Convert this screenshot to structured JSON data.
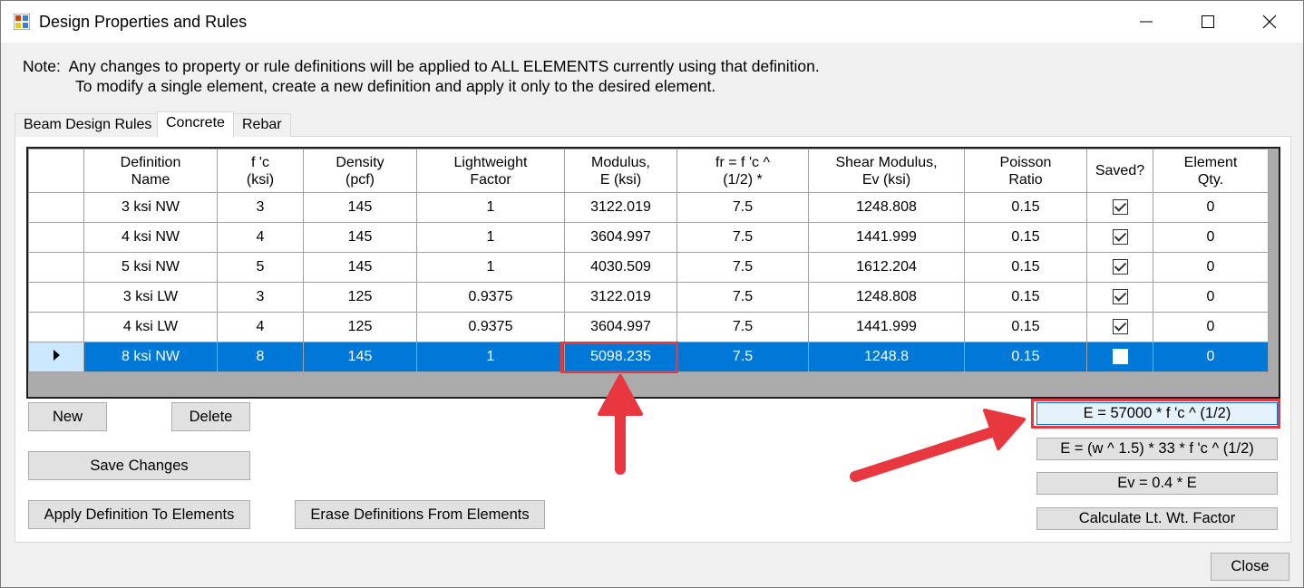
{
  "window": {
    "title": "Design Properties and Rules"
  },
  "note": {
    "line1": "Note:  Any changes to property or rule definitions will be applied to ALL ELEMENTS currently using that definition.",
    "line2": "To modify a single element, create a new definition and apply it only to the desired element."
  },
  "tabs": [
    {
      "label": "Beam Design Rules"
    },
    {
      "label": "Concrete"
    },
    {
      "label": "Rebar"
    }
  ],
  "grid": {
    "columns": [
      {
        "label": "Definition\nName"
      },
      {
        "label": "f 'c\n(ksi)"
      },
      {
        "label": "Density\n(pcf)"
      },
      {
        "label": "Lightweight\nFactor"
      },
      {
        "label": "Modulus,\nE (ksi)"
      },
      {
        "label": "fr = f 'c ^\n(1/2) *"
      },
      {
        "label": "Shear Modulus,\nEv (ksi)"
      },
      {
        "label": "Poisson\nRatio"
      },
      {
        "label": "Saved?"
      },
      {
        "label": "Element\nQty."
      }
    ],
    "rows": [
      {
        "name": "3 ksi NW",
        "fc": "3",
        "density": "145",
        "lw": "1",
        "modulus": "3122.019",
        "fr": "7.5",
        "shear": "1248.808",
        "poisson": "0.15",
        "saved": true,
        "qty": "0"
      },
      {
        "name": "4 ksi NW",
        "fc": "4",
        "density": "145",
        "lw": "1",
        "modulus": "3604.997",
        "fr": "7.5",
        "shear": "1441.999",
        "poisson": "0.15",
        "saved": true,
        "qty": "0"
      },
      {
        "name": "5 ksi NW",
        "fc": "5",
        "density": "145",
        "lw": "1",
        "modulus": "4030.509",
        "fr": "7.5",
        "shear": "1612.204",
        "poisson": "0.15",
        "saved": true,
        "qty": "0"
      },
      {
        "name": "3 ksi LW",
        "fc": "3",
        "density": "125",
        "lw": "0.9375",
        "modulus": "3122.019",
        "fr": "7.5",
        "shear": "1248.808",
        "poisson": "0.15",
        "saved": true,
        "qty": "0"
      },
      {
        "name": "4 ksi LW",
        "fc": "4",
        "density": "125",
        "lw": "0.9375",
        "modulus": "3604.997",
        "fr": "7.5",
        "shear": "1441.999",
        "poisson": "0.15",
        "saved": true,
        "qty": "0"
      },
      {
        "name": "8 ksi NW",
        "fc": "8",
        "density": "145",
        "lw": "1",
        "modulus": "5098.235",
        "fr": "7.5",
        "shear": "1248.8",
        "poisson": "0.15",
        "saved": false,
        "qty": "0",
        "selected": true
      }
    ]
  },
  "buttons": {
    "new": "New",
    "delete": "Delete",
    "save_changes": "Save Changes",
    "apply": "Apply Definition To Elements",
    "erase": "Erase Definitions From Elements",
    "formula_e": "E = 57000 * f 'c ^ (1/2)",
    "formula_e_w": "E = (w ^ 1.5) * 33 * f 'c ^ (1/2)",
    "formula_ev": "Ev = 0.4 * E",
    "calc_lw": "Calculate Lt. Wt. Factor",
    "close": "Close"
  },
  "colors": {
    "selection": "#0078d7",
    "annotation": "#e8373e"
  },
  "icons": {
    "app": "app-icon",
    "minimize": "minimize-icon",
    "maximize": "maximize-icon",
    "close": "close-icon",
    "row_indicator": "row-selector-arrow-icon"
  }
}
